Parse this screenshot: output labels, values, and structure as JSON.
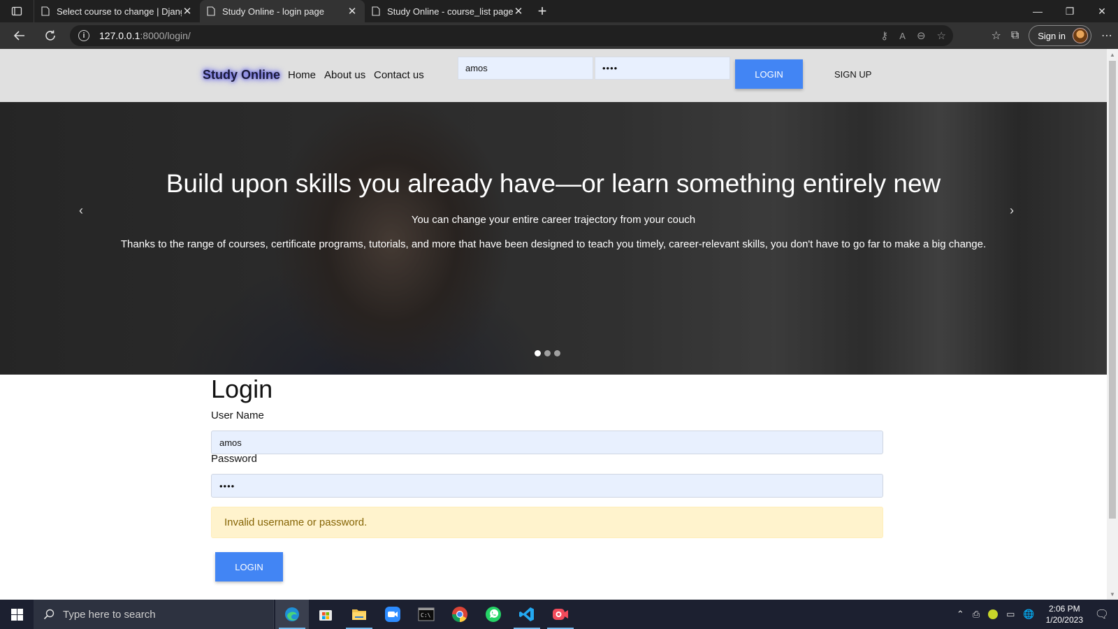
{
  "browser": {
    "tabs": [
      {
        "title": "Select course to change | Django site admin",
        "active": false
      },
      {
        "title": "Study Online - login page",
        "active": true
      },
      {
        "title": "Study Online - course_list page",
        "active": false
      }
    ],
    "url_host": "127.0.0.1",
    "url_rest": ":8000/login/",
    "signin_label": "Sign in"
  },
  "site": {
    "brand": "Study Online",
    "nav": [
      "Home",
      "About us",
      "Contact us"
    ],
    "top_username": "amos",
    "top_password_mask": "••••",
    "top_login": "LOGIN",
    "signup": "SIGN UP"
  },
  "hero": {
    "title": "Build upon skills you already have—or learn something entirely new",
    "subtitle": "You can change your entire career trajectory from your couch",
    "text": "Thanks to the range of courses, certificate programs, tutorials, and more that have been designed to teach you timely, career-relevant skills, you don't have to go far to make a big change.",
    "slide_count": 3,
    "active_slide": 1
  },
  "form": {
    "title": "Login",
    "username_label": "User Name",
    "username_value": "amos",
    "password_label": "Password",
    "password_mask": "••••",
    "error": "Invalid username or password.",
    "submit": "LOGIN"
  },
  "taskbar": {
    "search_placeholder": "Type here to search",
    "time": "2:06 PM",
    "date": "1/20/2023"
  },
  "colors": {
    "primary_button": "#4285f4",
    "alert_bg": "#fff3cd",
    "alert_text": "#856404",
    "input_autofill": "#e8f0fe"
  }
}
